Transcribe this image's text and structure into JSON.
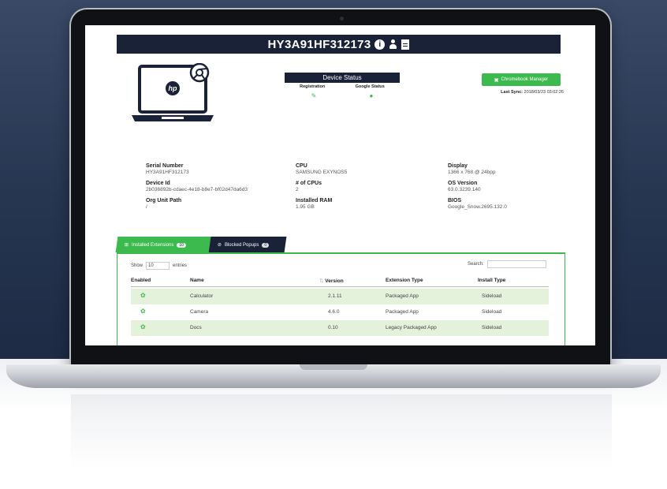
{
  "header": {
    "device_serial_title": "HY3A91HF312173"
  },
  "device_status": {
    "title": "Device Status",
    "col1": "Registration",
    "col2": "Google Status"
  },
  "chromebook_manager_button": "Chromebook Manager",
  "last_sync": {
    "label": "Last Sync:",
    "value": "2018/03/23 03:02:26"
  },
  "details": {
    "serial_number": {
      "label": "Serial Number",
      "value": "HY3A91HF312173"
    },
    "device_id": {
      "label": "Device Id",
      "value": "2b036892b-cdaec-4e18-b8e7-bf02d47da6d3"
    },
    "org_unit_path": {
      "label": "Org Unit Path",
      "value": "/"
    },
    "cpu": {
      "label": "CPU",
      "value": "SAMSUNG EXYNOS5"
    },
    "num_cpus": {
      "label": "# of CPUs",
      "value": "2"
    },
    "installed_ram": {
      "label": "Installed RAM",
      "value": "1.95 GB"
    },
    "display": {
      "label": "Display",
      "value": "1366 x 768 @ 24bpp"
    },
    "os_version": {
      "label": "OS Version",
      "value": "63.0.3239.140"
    },
    "bios": {
      "label": "BIOS",
      "value": "Google_Snow.2695.132.0"
    }
  },
  "tabs": [
    {
      "label": "Installed Extensions",
      "badge": "10"
    },
    {
      "label": "Blocked Popups",
      "badge": "0"
    }
  ],
  "table_controls": {
    "show_label": "Show",
    "show_value": "10",
    "entries_label": "entries",
    "search_label": "Search:"
  },
  "table": {
    "headers": [
      "Enabled",
      "Name",
      "Version",
      "Extension Type",
      "Install Type"
    ],
    "rows": [
      {
        "name": "Calculator",
        "version": "2.1.11",
        "type": "Packaged App",
        "install": "Sideload"
      },
      {
        "name": "Camera",
        "version": "4.6.0",
        "type": "Packaged App",
        "install": "Sideload"
      },
      {
        "name": "Docs",
        "version": "0.10",
        "type": "Legacy Packaged App",
        "install": "Sideload"
      }
    ]
  },
  "colors": {
    "navy": "#1a2238",
    "green": "#3dba4e",
    "row_stripe": "#e4f2dc"
  },
  "icons": {
    "title_icons": [
      "info-icon",
      "user-icon",
      "document-icon"
    ],
    "enabled": "gear-icon"
  }
}
